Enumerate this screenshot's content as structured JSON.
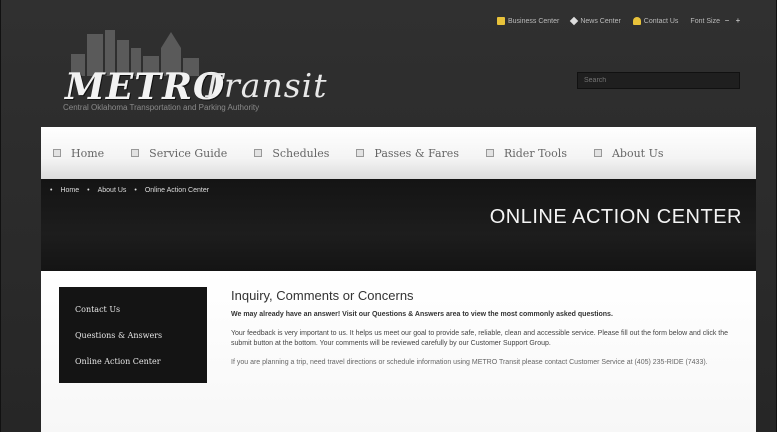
{
  "utility": {
    "business_center": "Business Center",
    "news_center": "News Center",
    "contact_us": "Contact Us",
    "font_size": "Font Size",
    "font_minus": "−",
    "font_plus": "+"
  },
  "logo": {
    "metro": "METRO",
    "transit": "Transit",
    "tagline": "Central Oklahoma Transportation and Parking Authority"
  },
  "search": {
    "placeholder": "Search"
  },
  "nav": {
    "items": [
      {
        "label": "Home"
      },
      {
        "label": "Service Guide"
      },
      {
        "label": "Schedules"
      },
      {
        "label": "Passes & Fares"
      },
      {
        "label": "Rider Tools"
      },
      {
        "label": "About Us"
      }
    ]
  },
  "breadcrumb": {
    "items": [
      "Home",
      "About Us",
      "Online Action Center"
    ]
  },
  "banner": {
    "title": "ONLINE ACTION CENTER"
  },
  "sidebar": {
    "items": [
      {
        "label": "Contact Us"
      },
      {
        "label": "Questions & Answers"
      },
      {
        "label": "Online Action Center"
      }
    ]
  },
  "main": {
    "heading": "Inquiry, Comments or Concerns",
    "lead": "We may already have an answer! Visit our Questions & Answers area to view the most commonly asked questions.",
    "body": "Your feedback is very important to us. It helps us meet our goal to provide safe, reliable, clean and accessible service. Please fill out the form below and click the submit button at the bottom. Your comments will be reviewed carefully by our Customer Support Group.",
    "tail": "If you are planning a trip, need travel directions or schedule information using METRO Transit please contact Customer Service at (405) 235-RIDE (7433)."
  },
  "colors": {
    "page_bg": "#2a2a2a",
    "banner_bg": "#141414",
    "nav_bg": "#f4f4f4",
    "logo_text": "#f2f2f2"
  }
}
